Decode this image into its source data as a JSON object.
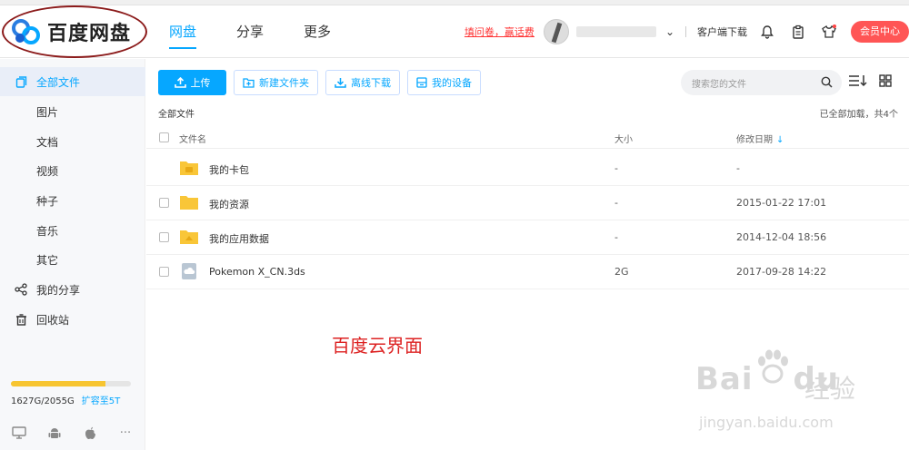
{
  "header": {
    "logo_text": "百度网盘",
    "nav": [
      {
        "label": "网盘",
        "active": true
      },
      {
        "label": "分享",
        "active": false
      },
      {
        "label": "更多",
        "active": false
      }
    ],
    "promo_link": "填问卷，赢话费",
    "client_download": "客户端下载",
    "vip_button": "会员中心"
  },
  "sidebar": {
    "items": [
      {
        "label": "全部文件",
        "icon": "all-files-icon",
        "active": true
      },
      {
        "label": "图片"
      },
      {
        "label": "文档"
      },
      {
        "label": "视频"
      },
      {
        "label": "种子"
      },
      {
        "label": "音乐"
      },
      {
        "label": "其它"
      },
      {
        "label": "我的分享",
        "icon": "share-icon"
      },
      {
        "label": "回收站",
        "icon": "trash-icon"
      }
    ],
    "quota": {
      "used_fraction": 0.79,
      "text": "1627G/2055G",
      "expand_label": "扩容至5T"
    },
    "devices": [
      "monitor-icon",
      "android-icon",
      "apple-icon",
      "more-icon"
    ]
  },
  "toolbar": {
    "upload": "上传",
    "new_folder": "新建文件夹",
    "offline_download": "离线下载",
    "my_devices": "我的设备",
    "search_placeholder": "搜索您的文件"
  },
  "listing": {
    "breadcrumb": "全部文件",
    "loaded_text": "已全部加载，共4个",
    "columns": {
      "name": "文件名",
      "size": "大小",
      "date": "修改日期"
    },
    "files": [
      {
        "name": "我的卡包",
        "size": "-",
        "date": "-",
        "icon": "folder-wallet-icon"
      },
      {
        "name": "我的资源",
        "size": "-",
        "date": "2015-01-22 17:01",
        "icon": "folder-icon"
      },
      {
        "name": "我的应用数据",
        "size": "-",
        "date": "2014-12-04 18:56",
        "icon": "folder-app-icon"
      },
      {
        "name": "Pokemon X_CN.3ds",
        "size": "2G",
        "date": "2017-09-28 14:22",
        "icon": "file-cloud-icon"
      }
    ]
  },
  "caption": "百度云界面",
  "watermark": {
    "brand": "Bai",
    "brand_du": "du",
    "cn": "经验",
    "url": "jingyan.baidu.com"
  },
  "colors": {
    "accent": "#06a7ff",
    "vip": "#ff5555",
    "annotation": "#dd2222",
    "folder": "#f9c638"
  }
}
